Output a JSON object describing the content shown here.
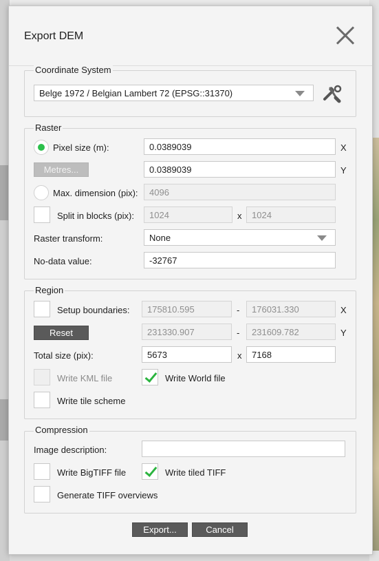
{
  "dialog": {
    "title": "Export DEM"
  },
  "coordinate_system": {
    "group_label": "Coordinate System",
    "selected": "Belge 1972 / Belgian Lambert 72 (EPSG::31370)",
    "tools_icon": "tools-icon"
  },
  "raster": {
    "group_label": "Raster",
    "pixel_size_label": "Pixel size (m):",
    "pixel_size_x": "0.0389039",
    "pixel_size_y": "0.0389039",
    "x_axis": "X",
    "y_axis": "Y",
    "units_button": "Metres...",
    "max_dimension_label": "Max. dimension (pix):",
    "max_dimension_value": "4096",
    "split_blocks_label": "Split in blocks (pix):",
    "split_x": "1024",
    "split_y": "1024",
    "times": "x",
    "transform_label": "Raster transform:",
    "transform_value": "None",
    "nodata_label": "No-data value:",
    "nodata_value": "-32767"
  },
  "region": {
    "group_label": "Region",
    "boundaries_label": "Setup boundaries:",
    "x_min": "175810.595",
    "x_max": "176031.330",
    "y_min": "231330.907",
    "y_max": "231609.782",
    "dash": "-",
    "x_axis": "X",
    "y_axis": "Y",
    "reset_button": "Reset",
    "total_size_label": "Total size (pix):",
    "total_w": "5673",
    "total_h": "7168",
    "times": "x",
    "kml_label": "Write KML file",
    "world_label": "Write World file",
    "tile_scheme_label": "Write tile scheme"
  },
  "compression": {
    "group_label": "Compression",
    "image_desc_label": "Image description:",
    "image_desc_value": "",
    "bigtiff_label": "Write BigTIFF file",
    "tiled_label": "Write tiled TIFF",
    "overviews_label": "Generate TIFF overviews"
  },
  "footer": {
    "export_button": "Export...",
    "cancel_button": "Cancel"
  },
  "colors": {
    "accent_green": "#2bc04b",
    "dialog_bg": "#f4f4f4",
    "dark_button": "#5a5a5a"
  }
}
